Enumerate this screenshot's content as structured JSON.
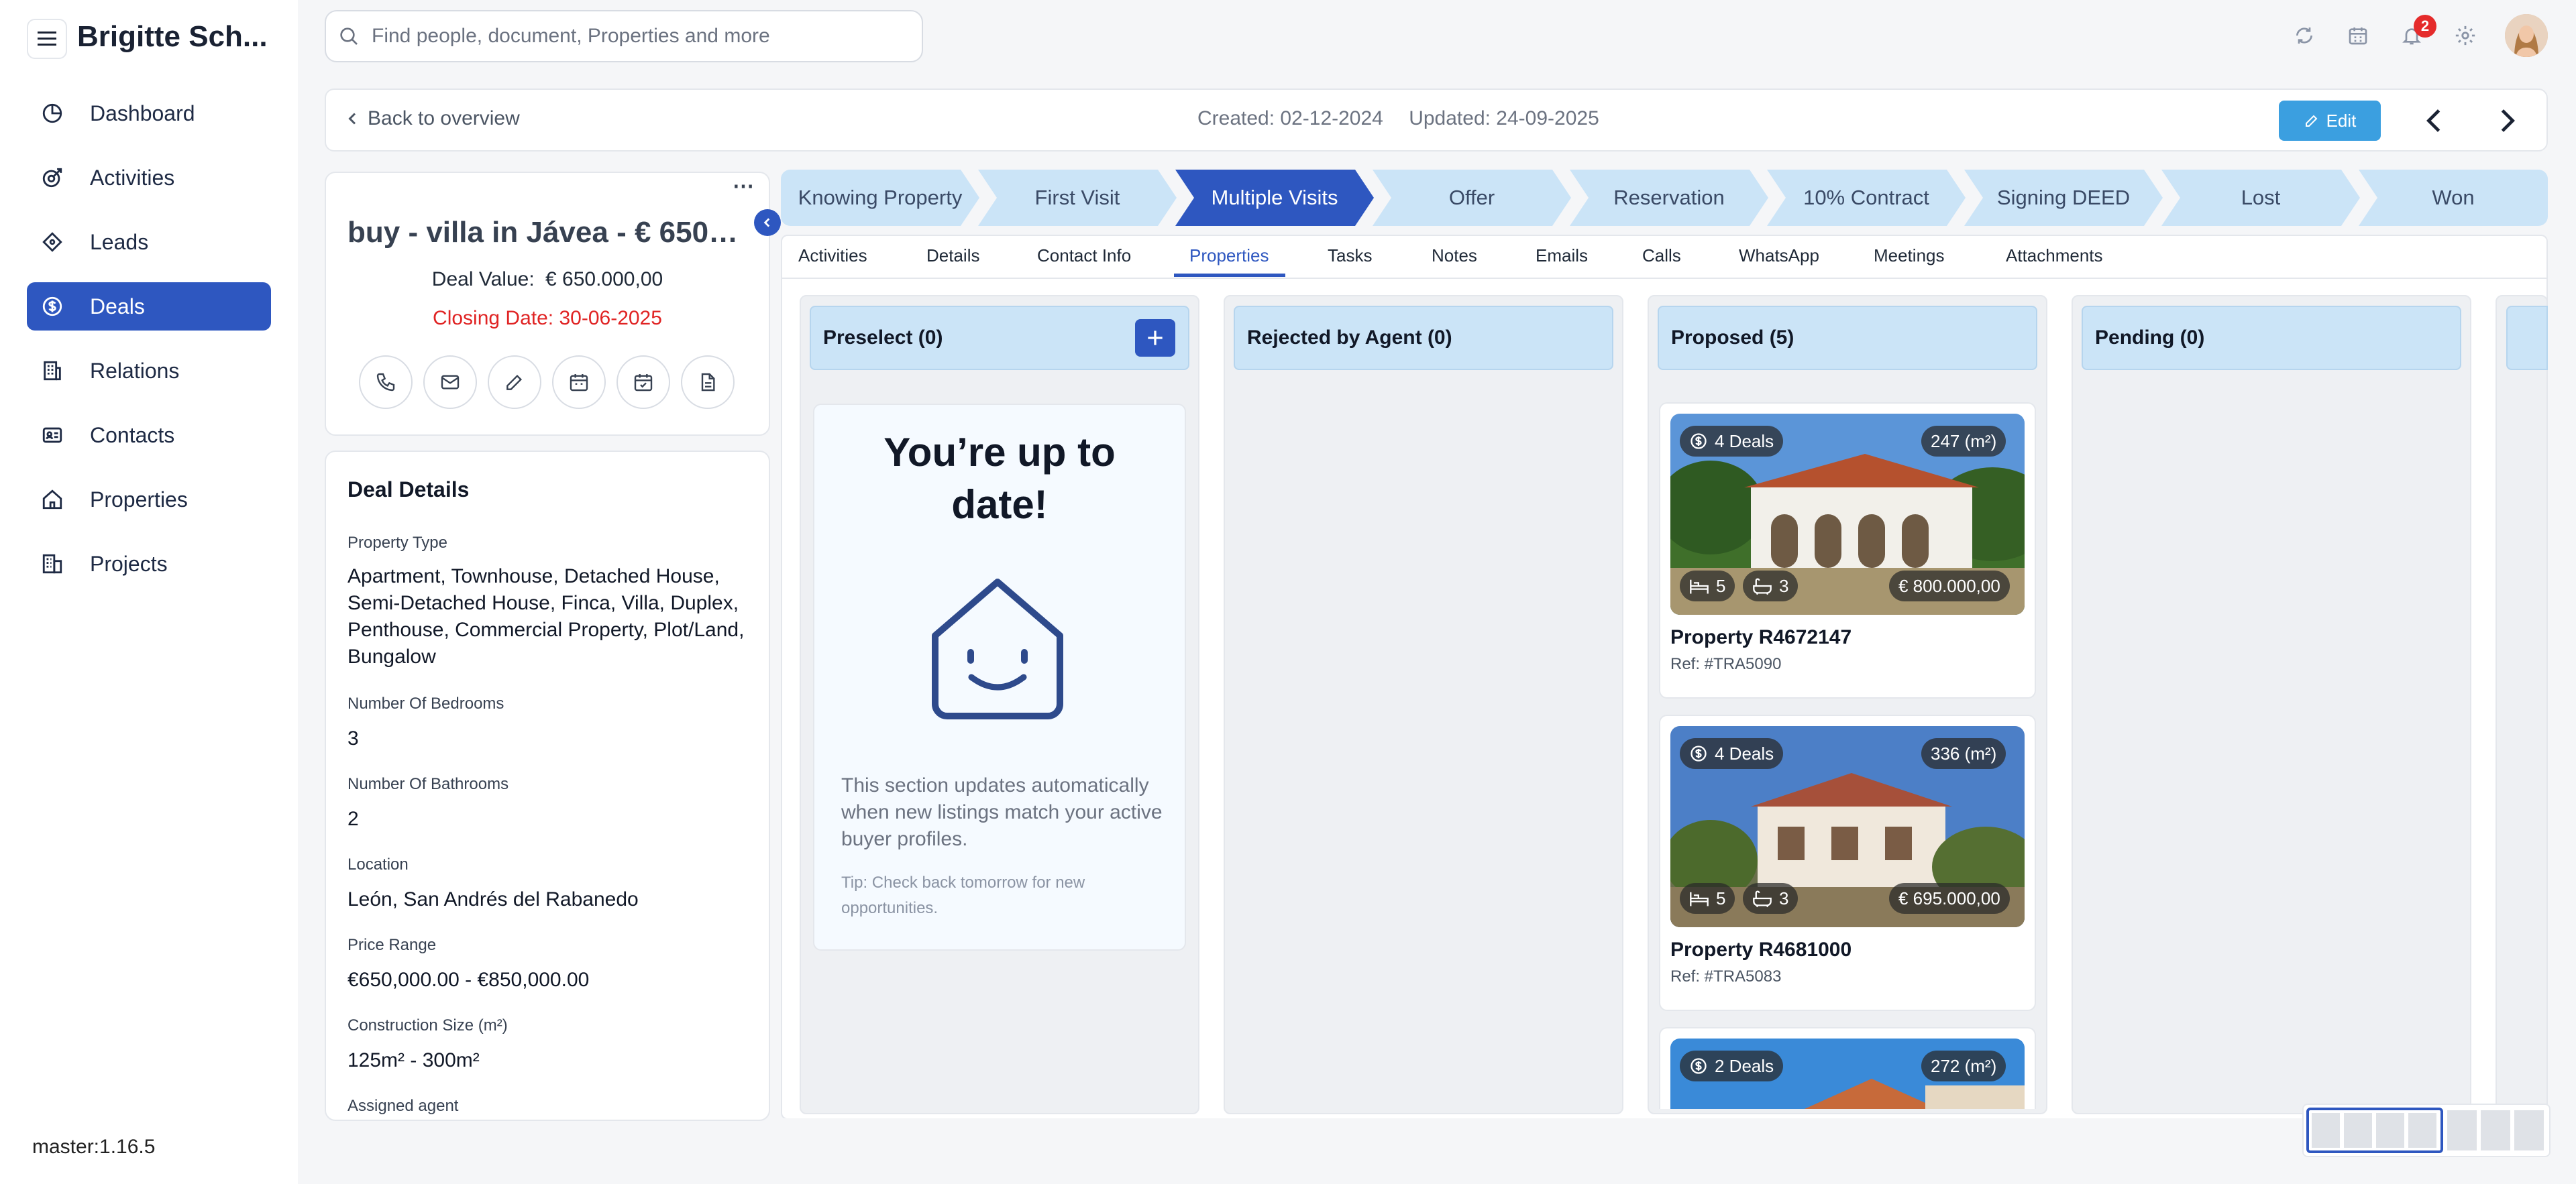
{
  "user": {
    "name": "Brigitte Sch..."
  },
  "nav": [
    {
      "label": "Dashboard",
      "icon": "dashboard-icon"
    },
    {
      "label": "Activities",
      "icon": "activities-icon"
    },
    {
      "label": "Leads",
      "icon": "leads-icon"
    },
    {
      "label": "Deals",
      "icon": "deals-icon",
      "active": true
    },
    {
      "label": "Relations",
      "icon": "relations-icon"
    },
    {
      "label": "Contacts",
      "icon": "contacts-icon"
    },
    {
      "label": "Properties",
      "icon": "properties-icon"
    },
    {
      "label": "Projects",
      "icon": "projects-icon"
    }
  ],
  "version": "master:1.16.5",
  "search": {
    "placeholder": "Find people, document, Properties and more"
  },
  "notifications": {
    "count": "2"
  },
  "header": {
    "back_label": "Back to overview",
    "created": "Created: 02-12-2024",
    "updated": "Updated: 24-09-2025",
    "edit_label": "Edit"
  },
  "deal": {
    "title": "buy - villa in Jávea - € 650.000",
    "value_label": "Deal Value:",
    "value": "€ 650.000,00",
    "closing": "Closing Date: 30-06-2025"
  },
  "details": {
    "heading": "Deal Details",
    "fields": [
      {
        "label": "Property Type",
        "value": "Apartment, Townhouse, Detached House, Semi-Detached House, Finca, Villa, Duplex, Penthouse, Commercial Property, Plot/Land, Bungalow"
      },
      {
        "label": "Number Of Bedrooms",
        "value": "3"
      },
      {
        "label": "Number Of Bathrooms",
        "value": "2"
      },
      {
        "label": "Location",
        "value": "León, San Andrés del Rabanedo"
      },
      {
        "label": "Price Range",
        "value": "€650,000.00 - €850,000.00"
      },
      {
        "label": "Construction Size (m²)",
        "value": "125m² - 300m²"
      },
      {
        "label": "Assigned agent",
        "value": ""
      }
    ]
  },
  "stages": [
    {
      "label": "Knowing Property"
    },
    {
      "label": "First Visit"
    },
    {
      "label": "Multiple Visits",
      "active": true
    },
    {
      "label": "Offer"
    },
    {
      "label": "Reservation"
    },
    {
      "label": "10% Contract"
    },
    {
      "label": "Signing DEED"
    },
    {
      "label": "Lost"
    },
    {
      "label": "Won"
    }
  ],
  "tabs": [
    "Activities",
    "Details",
    "Contact Info",
    "Properties",
    "Tasks",
    "Notes",
    "Emails",
    "Calls",
    "WhatsApp",
    "Meetings",
    "Attachments"
  ],
  "active_tab": "Properties",
  "columns": [
    {
      "title": "Preselect (0)"
    },
    {
      "title": "Rejected by Agent (0)"
    },
    {
      "title": "Proposed (5)"
    },
    {
      "title": "Pending (0)"
    }
  ],
  "empty_state": {
    "heading": "You’re up to date!",
    "text": "This section updates automatically when new listings match your active buyer profiles.",
    "tip": "Tip: Check back tomorrow for new opportunities."
  },
  "properties": [
    {
      "deals": "4 Deals",
      "size": "247 (m²)",
      "beds": "5",
      "baths": "3",
      "price": "€ 800.000,00",
      "name": "Property R4672147",
      "ref": "Ref: #TRA5090"
    },
    {
      "deals": "4 Deals",
      "size": "336 (m²)",
      "beds": "5",
      "baths": "3",
      "price": "€ 695.000,00",
      "name": "Property R4681000",
      "ref": "Ref: #TRA5083"
    },
    {
      "deals": "2 Deals",
      "size": "272 (m²)",
      "beds": "",
      "baths": "",
      "price": "",
      "name": "",
      "ref": ""
    }
  ],
  "colors": {
    "accent": "#2e57c0",
    "stage_bg": "#cbe4f7",
    "danger": "#e02424",
    "edit": "#3b9fe0"
  }
}
